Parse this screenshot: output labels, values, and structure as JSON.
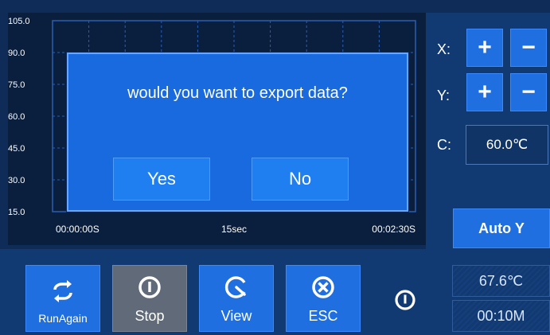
{
  "chart": {
    "y_ticks": [
      "105.0",
      "90.0",
      "75.0",
      "60.0",
      "45.0",
      "30.0",
      "15.0"
    ],
    "x_ticks": [
      "00:00:00S",
      "15sec",
      "00:02:30S"
    ]
  },
  "right_panel": {
    "x_label": "X:",
    "y_label": "Y:",
    "c_label": "C:",
    "plus": "+",
    "minus": "−",
    "c_value": "60.0℃",
    "auto_y": "Auto Y"
  },
  "bottom_bar": {
    "runagain": "RunAgain",
    "stop": "Stop",
    "view": "View",
    "esc": "ESC",
    "temperature": "67.6℃",
    "elapsed": "00:10M"
  },
  "dialog": {
    "message": "would you want to export data?",
    "yes": "Yes",
    "no": "No"
  },
  "colors": {
    "background": "#0f2c58",
    "button": "#1f6fe0",
    "stop_button": "#606a78",
    "chart_bg": "#0a1e3d",
    "grid": "#2c5fb0"
  }
}
